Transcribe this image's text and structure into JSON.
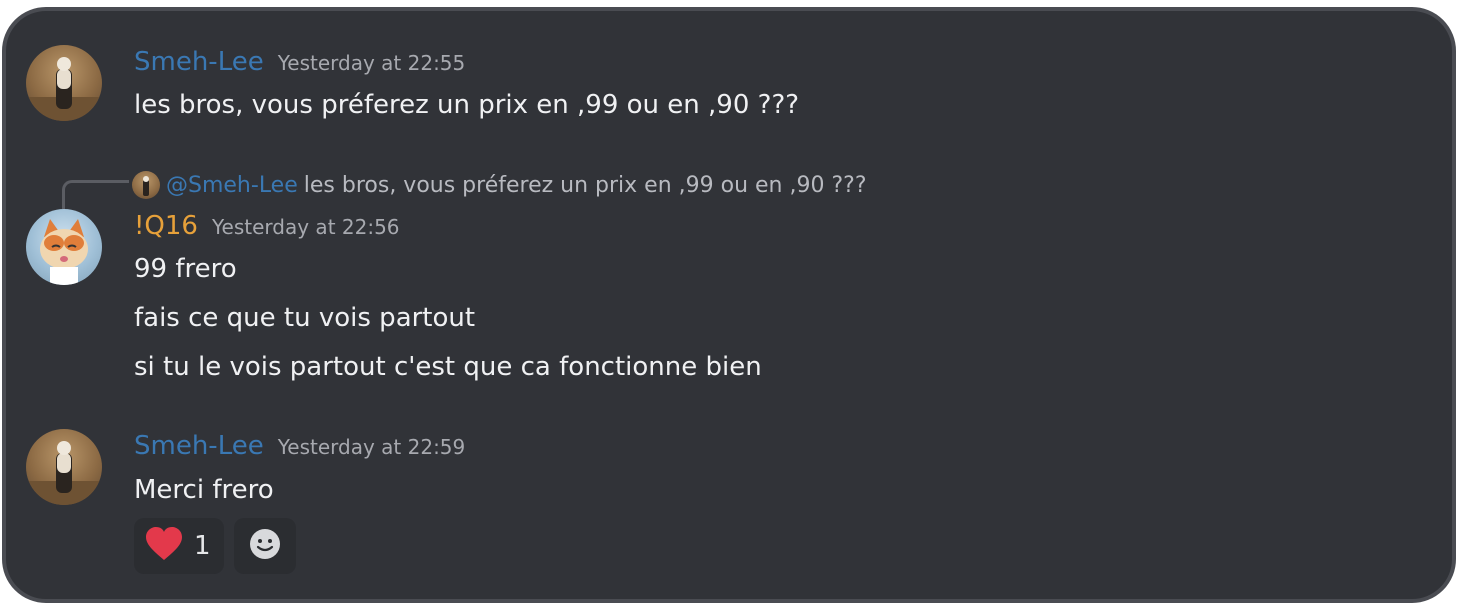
{
  "messages": [
    {
      "author": "Smeh-Lee",
      "timestamp": "Yesterday at 22:55",
      "lines": [
        "les bros, vous préferez un prix en ,99 ou en ,90 ???"
      ],
      "avatar": "desert-person-avatar",
      "author_color": "#3a78b3"
    },
    {
      "reply": {
        "mention": "@Smeh-Lee",
        "text": "les bros, vous préferez un prix en ,99 ou en ,90 ???"
      },
      "author": "!Q16",
      "timestamp": "Yesterday at 22:56",
      "lines": [
        "99 frero",
        "fais ce que tu vois partout",
        "si tu le vois partout c'est que ca fonctionne bien"
      ],
      "avatar": "cat-avatar",
      "author_color": "#e7a13a"
    },
    {
      "author": "Smeh-Lee",
      "timestamp": "Yesterday at 22:59",
      "lines": [
        "Merci frero"
      ],
      "avatar": "desert-person-avatar",
      "author_color": "#3a78b3",
      "reactions": [
        {
          "emoji": "heart-icon",
          "count": "1"
        },
        {
          "emoji": "add-reaction-icon"
        }
      ]
    }
  ],
  "colors": {
    "background": "#313338",
    "text": "#f0f1f3",
    "timestamp": "#a7a9af",
    "reaction_bg": "#2b2d31",
    "heart": "#e3394b"
  }
}
